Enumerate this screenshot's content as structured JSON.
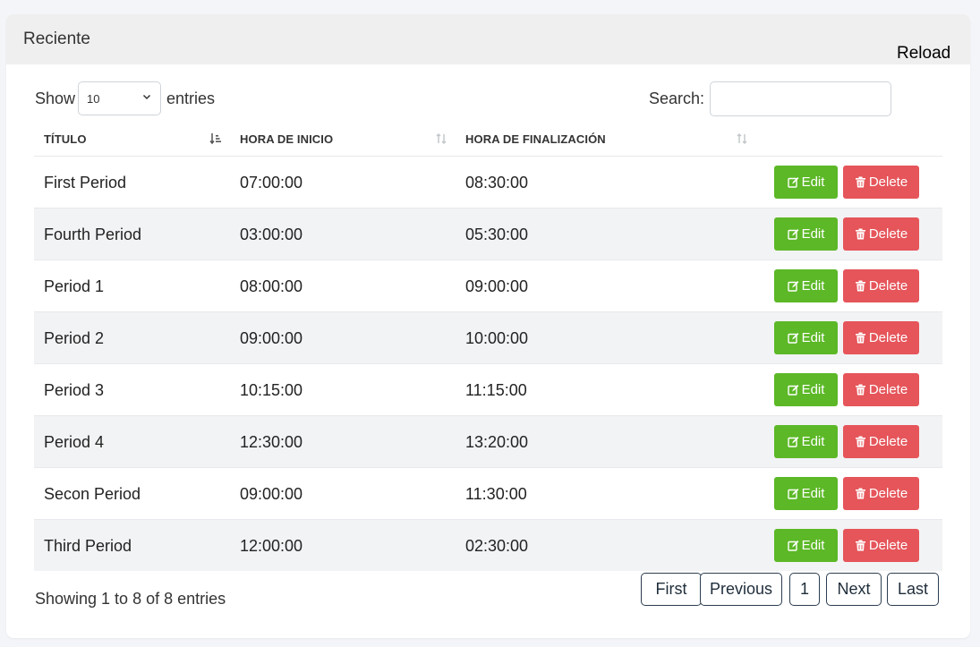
{
  "card": {
    "title": "Reciente",
    "reload_label": "Reload"
  },
  "controls": {
    "show_label": "Show",
    "entries_label": "entries",
    "page_length": "10",
    "search_label": "Search:",
    "search_value": ""
  },
  "table": {
    "headers": [
      "TÍTULO",
      "HORA DE INICIO",
      "HORA DE FINALIZACIÓN"
    ],
    "sort": {
      "column": "TÍTULO",
      "direction": "ascending"
    },
    "rows": [
      {
        "title": "First Period",
        "start": "07:00:00",
        "end": "08:30:00"
      },
      {
        "title": "Fourth Period",
        "start": "03:00:00",
        "end": "05:30:00"
      },
      {
        "title": "Period 1",
        "start": "08:00:00",
        "end": "09:00:00"
      },
      {
        "title": "Period 2",
        "start": "09:00:00",
        "end": "10:00:00"
      },
      {
        "title": "Period 3",
        "start": "10:15:00",
        "end": "11:15:00"
      },
      {
        "title": "Period 4",
        "start": "12:30:00",
        "end": "13:20:00"
      },
      {
        "title": "Secon Period",
        "start": "09:00:00",
        "end": "11:30:00"
      },
      {
        "title": "Third Period",
        "start": "12:00:00",
        "end": "02:30:00"
      }
    ],
    "actions": {
      "edit_label": "Edit",
      "delete_label": "Delete",
      "edit_icon": "edit-icon",
      "delete_icon": "trash-icon"
    }
  },
  "footer": {
    "info": "Showing 1 to 8 of 8 entries",
    "pagination": {
      "first": "First",
      "previous": "Previous",
      "current": "1",
      "next": "Next",
      "last": "Last"
    }
  },
  "colors": {
    "edit_button": "#5cb827",
    "delete_button": "#e5555a",
    "header_bg": "#efefef",
    "striped_row": "#f2f3f5",
    "page_background": "#f4f5f8"
  }
}
